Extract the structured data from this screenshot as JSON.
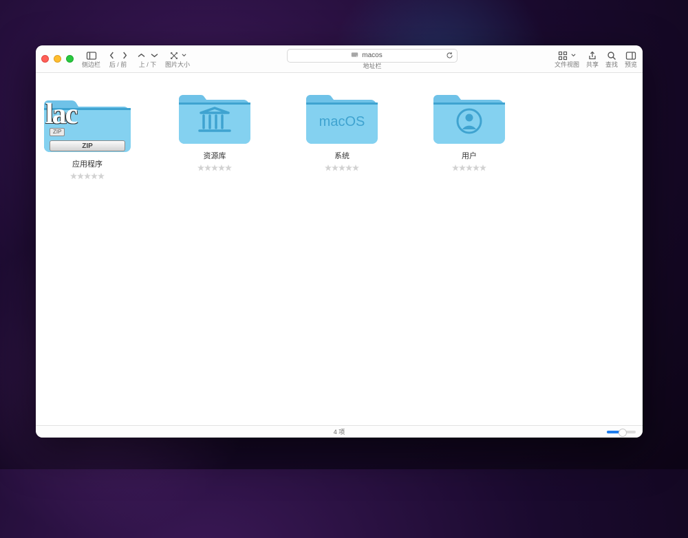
{
  "toolbar": {
    "sidebar_label": "侧边栏",
    "back_forward_label": "后 / 前",
    "up_down_label": "上 / 下",
    "image_size_label": "图片大小",
    "path_label": "地址栏",
    "path_current": "macos",
    "file_view_label": "文件视图",
    "share_label": "共享",
    "search_label": "查找",
    "preview_label": "预览"
  },
  "items": [
    {
      "label": "应用程序",
      "overlay_text": "lac",
      "zip_small": "ZIP",
      "zip_large": "ZIP"
    },
    {
      "label": "资源库"
    },
    {
      "label": "系统",
      "badge": "macOS"
    },
    {
      "label": "用户"
    }
  ],
  "status": {
    "count_text": "4 项"
  }
}
